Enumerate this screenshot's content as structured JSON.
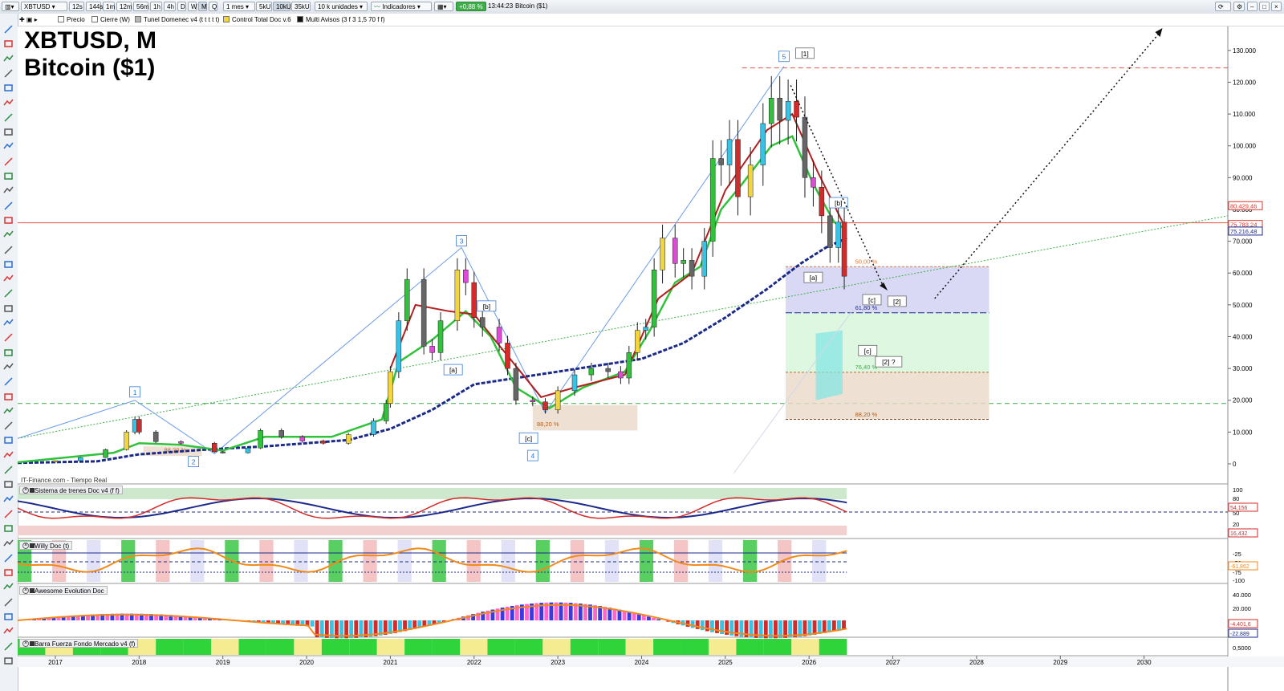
{
  "toolbar": {
    "symbol": "XBTUSD",
    "timeframes": [
      "12s",
      "144s",
      "1m",
      "12m",
      "56m",
      "1h",
      "4h",
      "D",
      "W",
      "M",
      "Q"
    ],
    "active_timeframe": "M",
    "period": "1 mes",
    "unit_buttons": [
      "5kU",
      "10kU",
      "35kU"
    ],
    "active_unit": "10kU",
    "units_select": "10 k unidades",
    "indicators_label": "Indicadores",
    "change_pct": "+0,88 %",
    "time": "13:44:23",
    "instrument_name": "Bitcoin ($1)"
  },
  "legend": {
    "items": [
      "Precio",
      "Cierre (W)",
      "Tunel Domenec v4 (t t t t t)",
      "Control Total Doc v.6",
      "Multi Avisos (3 f 3 1,5 70 f f)"
    ],
    "colors": [
      "#ffffff",
      "#ffffff",
      "#b7b7b7",
      "#f2d43c",
      "#111111"
    ]
  },
  "title": {
    "line1": "XBTUSD, M",
    "line2": "Bitcoin ($1)"
  },
  "source": "IT-Finance.com - Tiempo Real",
  "price_axis": {
    "labels": [
      "130.000",
      "120.000",
      "110.000",
      "100.000",
      "90.000",
      "80.000",
      "70.000",
      "60.000",
      "50.000",
      "40.000",
      "30.000",
      "20.000",
      "10.000",
      "0"
    ],
    "tags": [
      "80.429,46",
      "75.783,24",
      "75.216,48"
    ],
    "tag_colors": [
      "#d9362b",
      "#d9362b",
      "#1b2a8a"
    ]
  },
  "time_axis": {
    "labels": [
      "2017",
      "2018",
      "2019",
      "2020",
      "2021",
      "2022",
      "2023",
      "2024",
      "2025",
      "2026",
      "2027",
      "2028",
      "2029",
      "2030"
    ]
  },
  "waves": {
    "labels": [
      "1",
      "2",
      "3",
      "4",
      "5",
      "[1]",
      "[a]",
      "[b]",
      "[c]",
      "[a]",
      "[b]",
      "[c]",
      "[2]",
      "[c]",
      "[2] ?"
    ],
    "fib_labels": [
      "88,20 %",
      "88,20 %",
      "50,00 %",
      "61,80 %",
      "76,40 %",
      "88,20 %"
    ]
  },
  "panels": [
    {
      "title": "Sistema de trenes Doc v4 (f f)",
      "axis": [
        "100",
        "80",
        "50",
        "20",
        "0"
      ],
      "tags": [
        "54,156",
        "16,432"
      ]
    },
    {
      "title": "Willy Doc (t)",
      "axis": [
        "-25",
        "-50",
        "-75",
        "-100"
      ],
      "tags": [
        "-61,862"
      ]
    },
    {
      "title": "Awesome Evolution Doc",
      "axis": [
        "40.000",
        "20.000",
        "0"
      ],
      "tags": [
        "-4.401,6",
        "-22.889"
      ]
    },
    {
      "title": "Barra Fuerza Fondo Mercado v4 (f)",
      "axis": [
        "0,5000"
      ],
      "tags": []
    }
  ],
  "chart_data": {
    "type": "candlestick",
    "x_unit": "year",
    "y_unit": "USD",
    "ylim": [
      0,
      135000
    ],
    "xlim": [
      2016.55,
      2031.0
    ],
    "series": [
      {
        "name": "Precio",
        "points": [
          [
            2016.6,
            600
          ],
          [
            2017.0,
            1000
          ],
          [
            2017.3,
            2000
          ],
          [
            2017.6,
            4500
          ],
          [
            2017.85,
            10000
          ],
          [
            2017.95,
            14000
          ],
          [
            2018.0,
            10000
          ],
          [
            2018.2,
            7000
          ],
          [
            2018.5,
            6500
          ],
          [
            2018.9,
            3800
          ],
          [
            2019.0,
            3500
          ],
          [
            2019.3,
            5000
          ],
          [
            2019.45,
            10500
          ],
          [
            2019.7,
            8500
          ],
          [
            2019.95,
            7200
          ],
          [
            2020.2,
            6500
          ],
          [
            2020.5,
            9200
          ],
          [
            2020.8,
            13500
          ],
          [
            2020.95,
            19000
          ],
          [
            2021.0,
            29000
          ],
          [
            2021.1,
            45000
          ],
          [
            2021.2,
            58000
          ],
          [
            2021.4,
            37000
          ],
          [
            2021.5,
            35000
          ],
          [
            2021.6,
            45000
          ],
          [
            2021.8,
            61000
          ],
          [
            2021.9,
            57000
          ],
          [
            2022.0,
            46000
          ],
          [
            2022.1,
            43000
          ],
          [
            2022.3,
            38000
          ],
          [
            2022.4,
            30000
          ],
          [
            2022.5,
            20000
          ],
          [
            2022.7,
            19500
          ],
          [
            2022.85,
            17000
          ],
          [
            2023.0,
            23000
          ],
          [
            2023.2,
            28000
          ],
          [
            2023.4,
            30000
          ],
          [
            2023.6,
            29000
          ],
          [
            2023.75,
            27000
          ],
          [
            2023.85,
            35000
          ],
          [
            2023.95,
            42000
          ],
          [
            2024.05,
            43000
          ],
          [
            2024.15,
            61000
          ],
          [
            2024.25,
            71000
          ],
          [
            2024.4,
            63000
          ],
          [
            2024.5,
            64000
          ],
          [
            2024.6,
            59000
          ],
          [
            2024.75,
            70000
          ],
          [
            2024.85,
            96000
          ],
          [
            2024.95,
            94000
          ],
          [
            2025.05,
            102000
          ],
          [
            2025.15,
            84000
          ],
          [
            2025.3,
            94000
          ],
          [
            2025.45,
            107000
          ],
          [
            2025.55,
            115000
          ],
          [
            2025.65,
            108000
          ],
          [
            2025.75,
            114000
          ],
          [
            2025.85,
            109000
          ],
          [
            2025.95,
            90000
          ],
          [
            2026.05,
            87000
          ],
          [
            2026.15,
            78000
          ],
          [
            2026.25,
            68000
          ],
          [
            2026.35,
            76000
          ],
          [
            2026.42,
            59000
          ]
        ]
      }
    ],
    "levels": [
      {
        "name": "resistencia",
        "value": 124500,
        "color": "#e8534a"
      },
      {
        "name": "precio actual",
        "value": 75783,
        "color": "#e8534a"
      },
      {
        "name": "soporte",
        "value": 19000,
        "color": "#3fae4a"
      }
    ]
  }
}
